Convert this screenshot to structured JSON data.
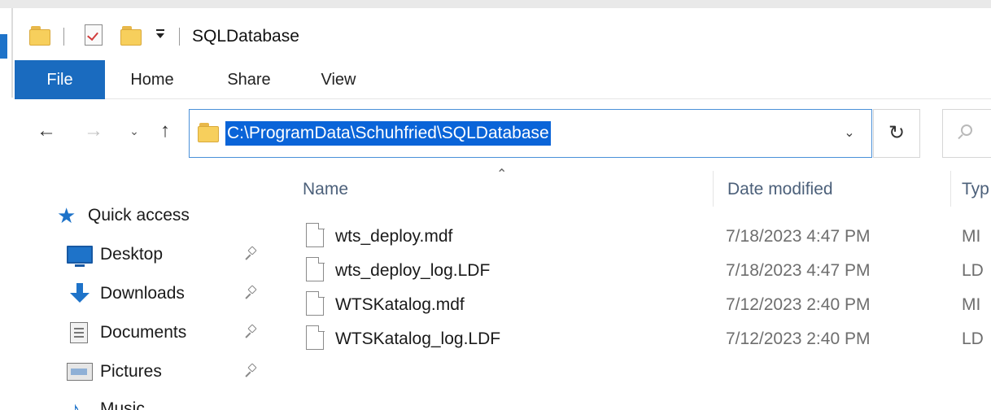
{
  "window": {
    "title": "SQLDatabase"
  },
  "ribbon": {
    "tabs": [
      {
        "label": "File"
      },
      {
        "label": "Home"
      },
      {
        "label": "Share"
      },
      {
        "label": "View"
      }
    ]
  },
  "navigation": {
    "address": "C:\\ProgramData\\Schuhfried\\SQLDatabase"
  },
  "sidebar": {
    "items": [
      {
        "label": "Quick access",
        "icon": "star-icon"
      },
      {
        "label": "Desktop",
        "icon": "desktop-icon",
        "pinned": true
      },
      {
        "label": "Downloads",
        "icon": "downloads-icon",
        "pinned": true
      },
      {
        "label": "Documents",
        "icon": "documents-icon",
        "pinned": true
      },
      {
        "label": "Pictures",
        "icon": "pictures-icon",
        "pinned": true
      },
      {
        "label": "Music",
        "icon": "music-icon"
      }
    ]
  },
  "columns": {
    "name": "Name",
    "date": "Date modified",
    "type": "Typ"
  },
  "files": [
    {
      "name": "wts_deploy.mdf",
      "date": "7/18/2023 4:47 PM",
      "type": "MI"
    },
    {
      "name": "wts_deploy_log.LDF",
      "date": "7/18/2023 4:47 PM",
      "type": "LD"
    },
    {
      "name": "WTSKatalog.mdf",
      "date": "7/12/2023 2:40 PM",
      "type": "MI"
    },
    {
      "name": "WTSKatalog_log.LDF",
      "date": "7/12/2023 2:40 PM",
      "type": "LD"
    }
  ],
  "colors": {
    "accent": "#1a6bbf",
    "selection": "#0a64d8",
    "folder": "#f7cf5c"
  }
}
